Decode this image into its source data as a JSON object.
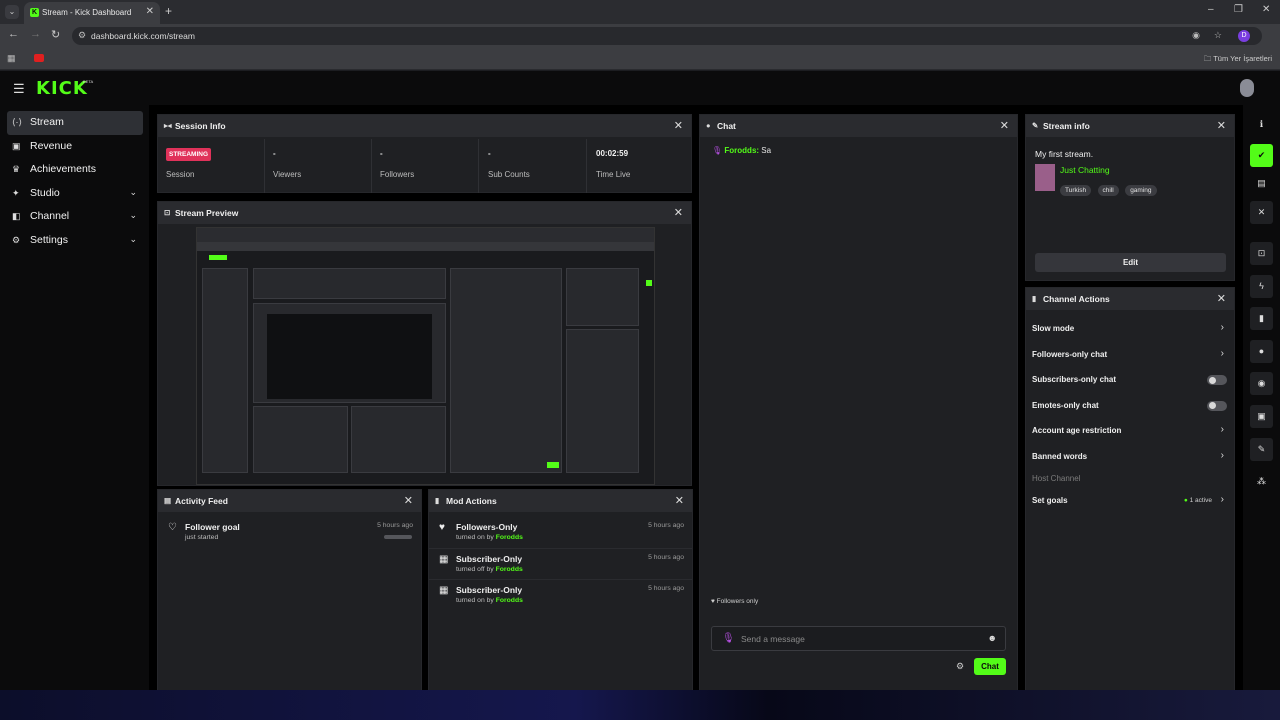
{
  "browser": {
    "tab_title": "Stream - Kick Dashboard",
    "tab_icon_letter": "K",
    "url": "dashboard.kick.com/stream",
    "profile_initial": "D",
    "bookmarks_all": "Tüm Yer İşaretleri"
  },
  "header": {
    "logo": "KICK",
    "beta": "BETA"
  },
  "sidebar": {
    "items": [
      {
        "label": "Stream",
        "icon": "stream-icon"
      },
      {
        "label": "Revenue",
        "icon": "revenue-icon"
      },
      {
        "label": "Achievements",
        "icon": "trophy-icon"
      },
      {
        "label": "Studio",
        "icon": "studio-icon"
      },
      {
        "label": "Channel",
        "icon": "channel-icon"
      },
      {
        "label": "Settings",
        "icon": "gear-icon"
      }
    ]
  },
  "session_info": {
    "title": "Session Info",
    "badge": "STREAMING",
    "session_label": "Session",
    "viewers_value": "-",
    "viewers_label": "Viewers",
    "followers_value": "-",
    "followers_label": "Followers",
    "subs_value": "-",
    "subs_label": "Sub Counts",
    "time_value": "00:02:59",
    "time_label": "Time Live"
  },
  "stream_preview": {
    "title": "Stream Preview"
  },
  "activity_feed": {
    "title": "Activity Feed",
    "items": [
      {
        "title": "Follower goal",
        "subtitle": "just started",
        "time": "5 hours ago"
      }
    ]
  },
  "mod_actions": {
    "title": "Mod Actions",
    "items": [
      {
        "title": "Followers-Only",
        "action": "turned on by",
        "user": "Forodds",
        "time": "5 hours ago"
      },
      {
        "title": "Subscriber-Only",
        "action": "turned off by",
        "user": "Forodds",
        "time": "5 hours ago"
      },
      {
        "title": "Subscriber-Only",
        "action": "turned on by",
        "user": "Forodds",
        "time": "5 hours ago"
      }
    ]
  },
  "chat": {
    "title": "Chat",
    "messages": [
      {
        "user": "Forodds:",
        "text": " Sa"
      }
    ],
    "followers_only": "Followers only",
    "placeholder": "Send a message",
    "send_label": "Chat"
  },
  "stream_info": {
    "title": "Stream info",
    "stream_title": "My first stream.",
    "category": "Just Chatting",
    "tags": [
      "Turkish",
      "chill",
      "gaming"
    ],
    "edit_label": "Edit"
  },
  "channel_actions": {
    "title": "Channel Actions",
    "rows": [
      {
        "label": "Slow mode",
        "control": "chevron"
      },
      {
        "label": "Followers-only chat",
        "control": "chevron"
      },
      {
        "label": "Subscribers-only chat",
        "control": "toggle-off"
      },
      {
        "label": "Emotes-only chat",
        "control": "toggle-off"
      },
      {
        "label": "Account age restriction",
        "control": "chevron"
      },
      {
        "label": "Banned words",
        "control": "chevron"
      },
      {
        "label": "Host Channel",
        "control": "disabled"
      },
      {
        "label": "Set goals",
        "control": "chevron"
      }
    ],
    "goals_status": "1 active"
  },
  "colors": {
    "accent": "#53fc18",
    "live_badge": "#e0325a",
    "panel_bg": "#1f2023"
  }
}
